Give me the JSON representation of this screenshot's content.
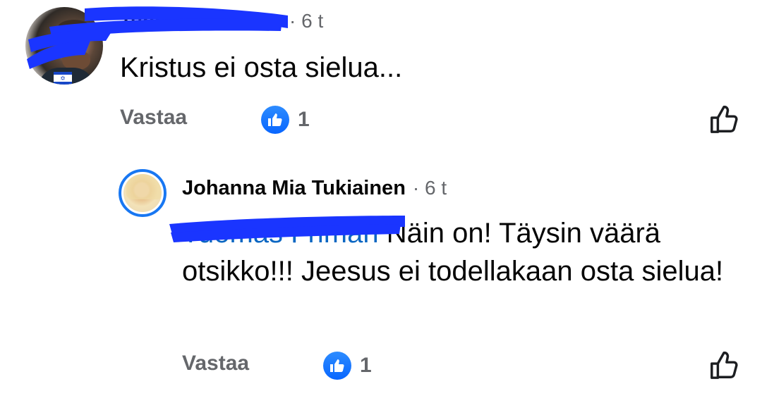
{
  "comments": [
    {
      "author": "Tuomas Friman",
      "time": "· 6 t",
      "text": "Kristus ei osta sielua...",
      "reply_label": "Vastaa",
      "reaction_count": "1",
      "reaction_icon": "like-icon",
      "avatar_flag": "✡"
    }
  ],
  "reply": {
    "author": "Johanna Mia Tukiainen",
    "time": "· 6 t",
    "mention": "Tuomas Friman",
    "text": " Näin on! Täysin väärä otsikko!!! Jeesus ei todellakaan osta sielua!",
    "reply_label": "Vastaa",
    "reaction_count": "1",
    "reaction_icon": "like-icon"
  },
  "colors": {
    "accent": "#0866ff",
    "mention": "#0a66c2",
    "meta": "#65676b",
    "redaction": "#1a35ff"
  }
}
